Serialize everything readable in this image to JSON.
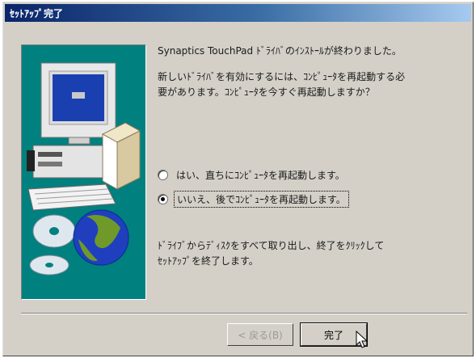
{
  "window": {
    "title": "ｾｯﾄｱｯﾌﾟ完了"
  },
  "content": {
    "heading": "Synaptics TouchPad ﾄﾞﾗｲﾊﾞのｲﾝｽﾄｰﾙが終わりました。",
    "prompt_line1": "新しいﾄﾞﾗｲﾊﾞを有効にするには、ｺﾝﾋﾟｭｰﾀを再起動する必",
    "prompt_line2": "要があります。ｺﾝﾋﾟｭｰﾀを今すぐ再起動しますか？",
    "options": [
      {
        "label": "はい、直ちにｺﾝﾋﾟｭｰﾀを再起動します。",
        "checked": false
      },
      {
        "label": "いいえ、後でｺﾝﾋﾟｭｰﾀを再起動します。",
        "checked": true
      }
    ],
    "footer_line1": "ﾄﾞﾗｲﾌﾞからﾃﾞｨｽｸをすべて取り出し、終了をｸﾘｯｸして",
    "footer_line2": "ｾｯﾄｱｯﾌﾟを終了します。"
  },
  "buttons": {
    "back_label": "< 戻る(B)",
    "finish_label": "完了"
  }
}
